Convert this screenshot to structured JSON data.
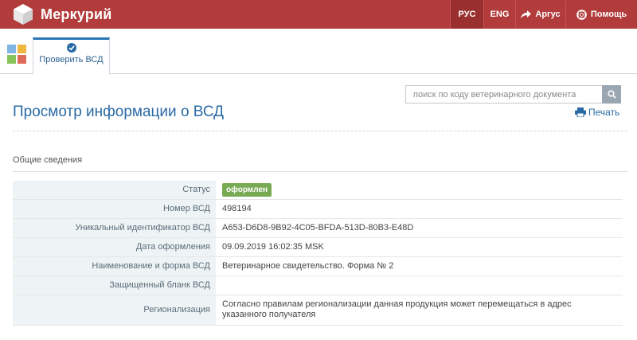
{
  "header": {
    "app_name": "Меркурий",
    "nav": [
      {
        "label": "РУС",
        "active": true
      },
      {
        "label": "ENG",
        "active": false
      },
      {
        "label": "Аргус",
        "icon": "share-arrow-icon"
      },
      {
        "label": "Помощь",
        "icon": "lifebuoy-icon"
      }
    ]
  },
  "colors": {
    "header_bg": "#b23b3b",
    "accent": "#2a6aa5",
    "status_badge": "#78aa54"
  },
  "tabs": [
    {
      "label": "Проверить ВСД",
      "icon": "check-circle-icon",
      "active": true
    }
  ],
  "search": {
    "placeholder": "поиск по коду ветеринарного документа"
  },
  "page": {
    "title": "Просмотр информации о ВСД",
    "print_label": "Печать",
    "section_title": "Общие сведения"
  },
  "details": [
    {
      "label": "Статус",
      "value": "оформлен"
    },
    {
      "label": "Номер ВСД",
      "value": "498194"
    },
    {
      "label": "Уникальный идентификатор ВСД",
      "value": "A653-D6D8-9B92-4C05-BFDA-513D-80B3-E48D"
    },
    {
      "label": "Дата оформления",
      "value": "09.09.2019 16:02:35 MSK"
    },
    {
      "label": "Наименование и форма ВСД",
      "value": "Ветеринарное свидетельство. Форма № 2"
    },
    {
      "label": "Защищенный бланк ВСД",
      "value": ""
    },
    {
      "label": "Регионализация",
      "value": "Согласно правилам регионализации данная продукция может перемещаться в адрес указанного получателя"
    }
  ]
}
